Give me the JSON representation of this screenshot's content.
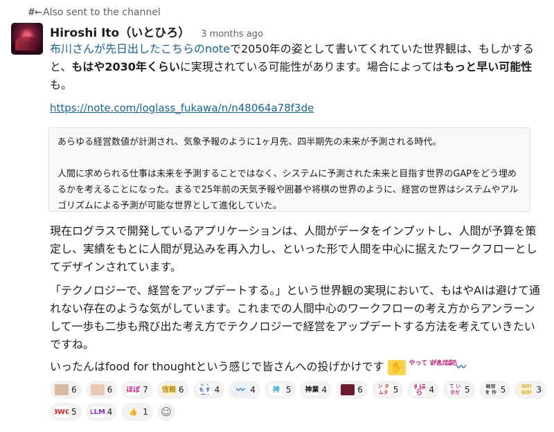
{
  "meta": {
    "sent_label": "Also sent to the channel"
  },
  "author": {
    "name": "Hiroshi Ito（いとひろ）",
    "time": "3 months ago"
  },
  "message": {
    "p1": {
      "link_text": "布川さんが先日出したこちらのnote",
      "text_a": "で2050年の姿として書いてくれていた世界観は、もしかすると、",
      "bold_a": "もはや2030年くらい",
      "text_b": "に実現されている可能性があります。場合によっては",
      "bold_b": "もっと早い可能性",
      "text_c": "も。"
    },
    "url": "https://note.com/loglass_fukawa/n/n48064a78f3de",
    "quote": {
      "line1": "あらゆる経営数値が計測され、気象予報のように1ヶ月先、四半期先の未来が予測される時代。",
      "line2": "人間に求められる仕事は未来を予測することではなく、システムに予測された未来と目指す世界のGAPをどう埋めるかを考えることになった。まるで25年前の天気予報や囲碁や将棋の世界のように、経営の世界はシステムやアルゴリズムによる予測が可能な世界として進化していた。"
    },
    "p2": "現在ログラスで開発しているアプリケーションは、人間がデータをインプットし、人間が予算を策定し、実績をもとに人間が見込みを再入力し、といった形で人間を中心に据えたワークフローとしてデザインされています。",
    "p3": "「テクノロジーで、経営をアップデートする。」という世界観の実現において、もはやAIは避けて通れない存在のような気がしています。これまでの人間中心のワークフローの考え方からアンラーンして一歩も二歩も飛び出た考え方でテクノロジーで経営をアップデートする方法を考えていきたいですね。",
    "p4": "いったんはfood for thoughtという感じで皆さんへの投げかけです",
    "inline_emojis": [
      "やって いきだよ",
      "がん ばろ"
    ]
  },
  "reactions": [
    {
      "icon": "face-photo-1",
      "label": "",
      "count": "6",
      "bg": "#d9b9a0",
      "fg": "#5a3a2a"
    },
    {
      "icon": "face-photo-2",
      "label": "",
      "count": "6",
      "bg": "#e8c8b0",
      "fg": "#5a3a2a"
    },
    {
      "icon": "text-emoji",
      "label": "ほぼ",
      "count": "7",
      "bg": "#ffffff",
      "fg": "#d61b8c"
    },
    {
      "icon": "text-emoji",
      "label": "信頼",
      "count": "6",
      "bg": "#fff4c9",
      "fg": "#b88a00"
    },
    {
      "icon": "text-emoji",
      "label": "とても すごい",
      "count": "4",
      "bg": "#ffffff",
      "fg": "#2458c8"
    },
    {
      "icon": "whale-icon",
      "label": "",
      "count": "4",
      "bg": "#e6f1fb",
      "fg": "#1f6fd1"
    },
    {
      "icon": "text-emoji",
      "label": "神",
      "count": "5",
      "bg": "#ffffff",
      "fg": "#28a7d8"
    },
    {
      "icon": "text-emoji",
      "label": "神業",
      "count": "4",
      "bg": "#ffffff",
      "fg": "#111111"
    },
    {
      "icon": "avatar-photo",
      "label": "",
      "count": "6",
      "bg": "#6b1a30",
      "fg": "#ffffff"
    },
    {
      "icon": "text-emoji",
      "label": "モメン タムタム",
      "count": "5",
      "bg": "#ffffff",
      "fg": "#d43a2a"
    },
    {
      "icon": "text-emoji",
      "label": "すばら",
      "count": "4",
      "bg": "#ffffff",
      "fg": "#d6287a"
    },
    {
      "icon": "text-emoji",
      "label": "やって いきだよ",
      "count": "5",
      "bg": "#ffffff",
      "fg": "#c42a7a"
    },
    {
      "icon": "text-emoji",
      "label": "担い 経営を 作ろう",
      "count": "5",
      "bg": "#ffffff",
      "fg": "#333333"
    },
    {
      "icon": "text-emoji",
      "label": "GO! GO!",
      "count": "3",
      "bg": "#fff3d6",
      "fg": "#e0a21a"
    },
    {
      "icon": "text-emoji",
      "label": "BWG",
      "count": "5",
      "bg": "#ffffff",
      "fg": "#e0231f"
    },
    {
      "icon": "text-emoji",
      "label": "LLM",
      "count": "4",
      "bg": "#ffffff",
      "fg": "#8a2ad6"
    },
    {
      "icon": "thumbs-up-icon",
      "label": "👍",
      "count": "1",
      "bg": "transparent",
      "fg": "#e0a21a"
    }
  ],
  "colors": {
    "link": "#1264a3",
    "reaction_bg": "#f2f2f2"
  }
}
